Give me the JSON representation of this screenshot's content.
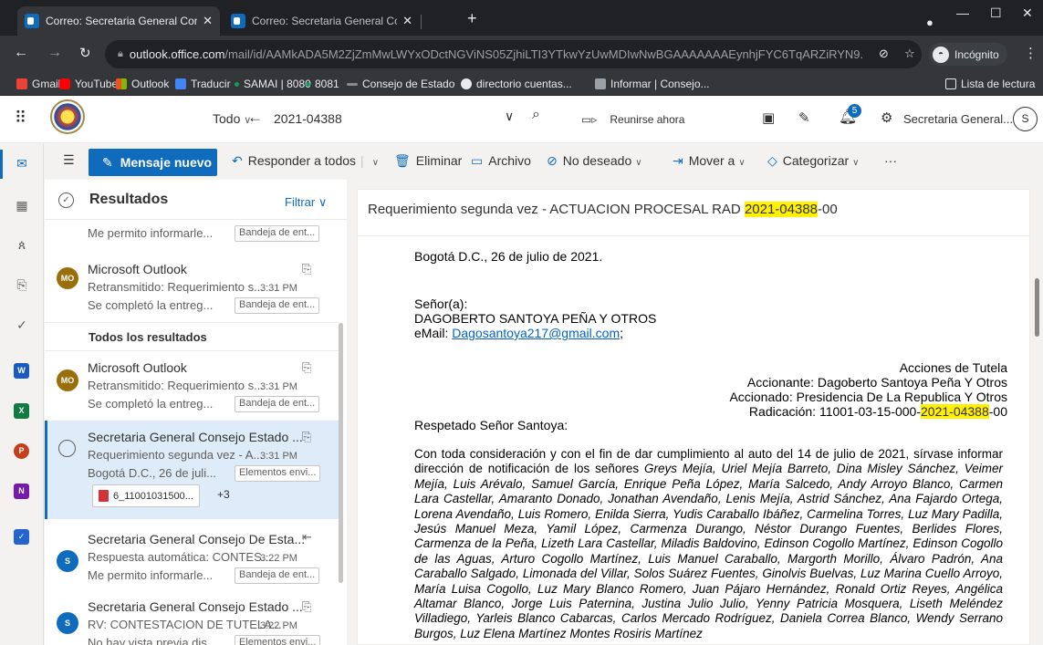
{
  "browser": {
    "tabs": [
      {
        "title": "Correo: Secretaria General Conse"
      },
      {
        "title": "Correo: Secretaria General Conse"
      },
      {
        "title": "Correo: Secretaria General Conse"
      }
    ],
    "url_domain": "outlook.office.com",
    "url_path": "/mail/id/AAMkADA5M2ZjZmMwLWYxODctNGViNS05ZjhiLTI3YTkwYzUwMDIwNwBGAAAAAAAEynhjFYC6TqARZiRYN9...",
    "profile_label": "Incógnito",
    "bookmarks": [
      "Gmail",
      "YouTube",
      "Outlook",
      "Traducir",
      "SAMAI | 8080",
      "8081",
      "Consejo de Estado",
      "directorio cuentas...",
      "Informar | Consejo..."
    ],
    "reading_list": "Lista de lectura"
  },
  "owa": {
    "search_scope": "Todo",
    "search_query": "2021-04388",
    "meet_now": "Reunirse ahora",
    "notif_count": "5",
    "account_name": "Secretaria General...",
    "account_initial": "S"
  },
  "toolbar": {
    "new_message": "Mensaje nuevo",
    "reply_all": "Responder a todos",
    "delete": "Eliminar",
    "archive": "Archivo",
    "junk": "No deseado",
    "move": "Mover a",
    "categorize": "Categorizar",
    "more": "···"
  },
  "list": {
    "title": "Resultados",
    "filter": "Filtrar",
    "section_all": "Todos los resultados",
    "rows": [
      {
        "preview": "Me permito informarle...",
        "folder": "Bandeja de ent..."
      },
      {
        "sender": "Microsoft Outlook",
        "subject": "Retransmitido: Requerimiento s...",
        "time": "3:31 PM",
        "preview": "Se completó la entreg...",
        "folder": "Bandeja de ent...",
        "initials": "MO"
      },
      {
        "sender": "Microsoft Outlook",
        "subject": "Retransmitido: Requerimiento s...",
        "time": "3:31 PM",
        "preview": "Se completó la entreg...",
        "folder": "Bandeja de ent...",
        "initials": "MO"
      },
      {
        "sender": "Secretaria General Consejo Estado ...",
        "subject": "Requerimiento segunda vez - A...",
        "time": "3:31 PM",
        "preview": "Bogotá D.C., 26 de juli...",
        "folder": "Elementos envi...",
        "attachment": "6_11001031500...",
        "more": "+3"
      },
      {
        "sender": "Secretaria General Consejo De Esta...",
        "subject": "Respuesta automática: CONTES...",
        "time": "3:22 PM",
        "preview": "Me permito informarle...",
        "folder": "Bandeja de ent...",
        "initials": "S"
      },
      {
        "sender": "Secretaria General Consejo Estado ...",
        "subject": "RV: CONTESTACION DE TUTELA...",
        "time": "3:22 PM",
        "preview": "No hay vista previa dis...",
        "folder": "Elementos envi...",
        "initials": "S"
      }
    ]
  },
  "message": {
    "subject_prefix": "Requerimiento segunda vez - ACTUACION PROCESAL RAD ",
    "subject_highlight": "2021-04388",
    "subject_suffix": "-00",
    "date_line": "Bogotá D.C., 26 de julio de 2021.",
    "salutation_label": "Señor(a):",
    "recipient": "DAGOBERTO SANTOYA PEÑA Y OTROS",
    "email_label": "eMail: ",
    "email": "Dagosantoya217@gmail.com",
    "email_suffix": ";",
    "case_type": "Acciones de Tutela",
    "accionante": "Accionante: Dagoberto Santoya Peña Y Otros",
    "accionado": "Accionado: Presidencia De La Republica Y Otros",
    "radicacion_prefix": "Radicación: 11001-03-15-000-",
    "radicacion_highlight": "2021-04388",
    "radicacion_suffix": "-00",
    "greeting": "Respetado Señor Santoya:",
    "para_intro": "Con toda consideración y con el fin de dar  cumplimiento al auto del 14 de julio de 2021, sírvase informar dirección de notificación de los señores ",
    "para_names": "Greys Mejía, Uriel Mejía Barreto, Dina Misley Sánchez, Veimer Mejía, Luis Arévalo, Samuel García, Enrique Peña López, María Salcedo, Andy Arroyo Blanco, Carmen Lara Castellar, Amaranto Donado, Jonathan Avendaño, Lenis Mejía, Astrid Sánchez, Ana Fajardo Ortega, Lorena Avendaño, Luis Romero, Enilda Sierra, Yudis Caraballo Ibáñez, Carmelina Torres, Luz Mary Padilla, Jesús Manuel Meza, Yamil López, Carmenza Durango, Néstor Durango Fuentes, Berlides Flores, Carmenza de la Peña, Lizeth Lara Castellar, Miladis Baldovino, Edinson Cogollo Martínez, Edinson Cogollo de las Aguas, Arturo Cogollo Martínez, Luis Manuel Caraballo, Margorth Morillo, Álvaro Padrón, Ana Caraballo Salgado, Limonada del Villar, Solos Suárez Fuentes, Ginolvis Buelvas, Luz Marina Cuello Arroyo, María Luisa Cogollo, Luz Mary Blanco Romero, Juan Pájaro Hernández, Ronald Ortiz Reyes, Angélica Altamar Blanco, Jorge Luis Paternina, Justina Julio Julio, Yenny Patricia Mosquera, Liseth Meléndez Villadiego, Yarleis Blanco Cabarcas, Carlos Mercado Rodríguez, Daniela Correa Blanco, Wendy Serrano Burgos, Luz Elena Martínez Montes  Rosiris Martínez"
  }
}
